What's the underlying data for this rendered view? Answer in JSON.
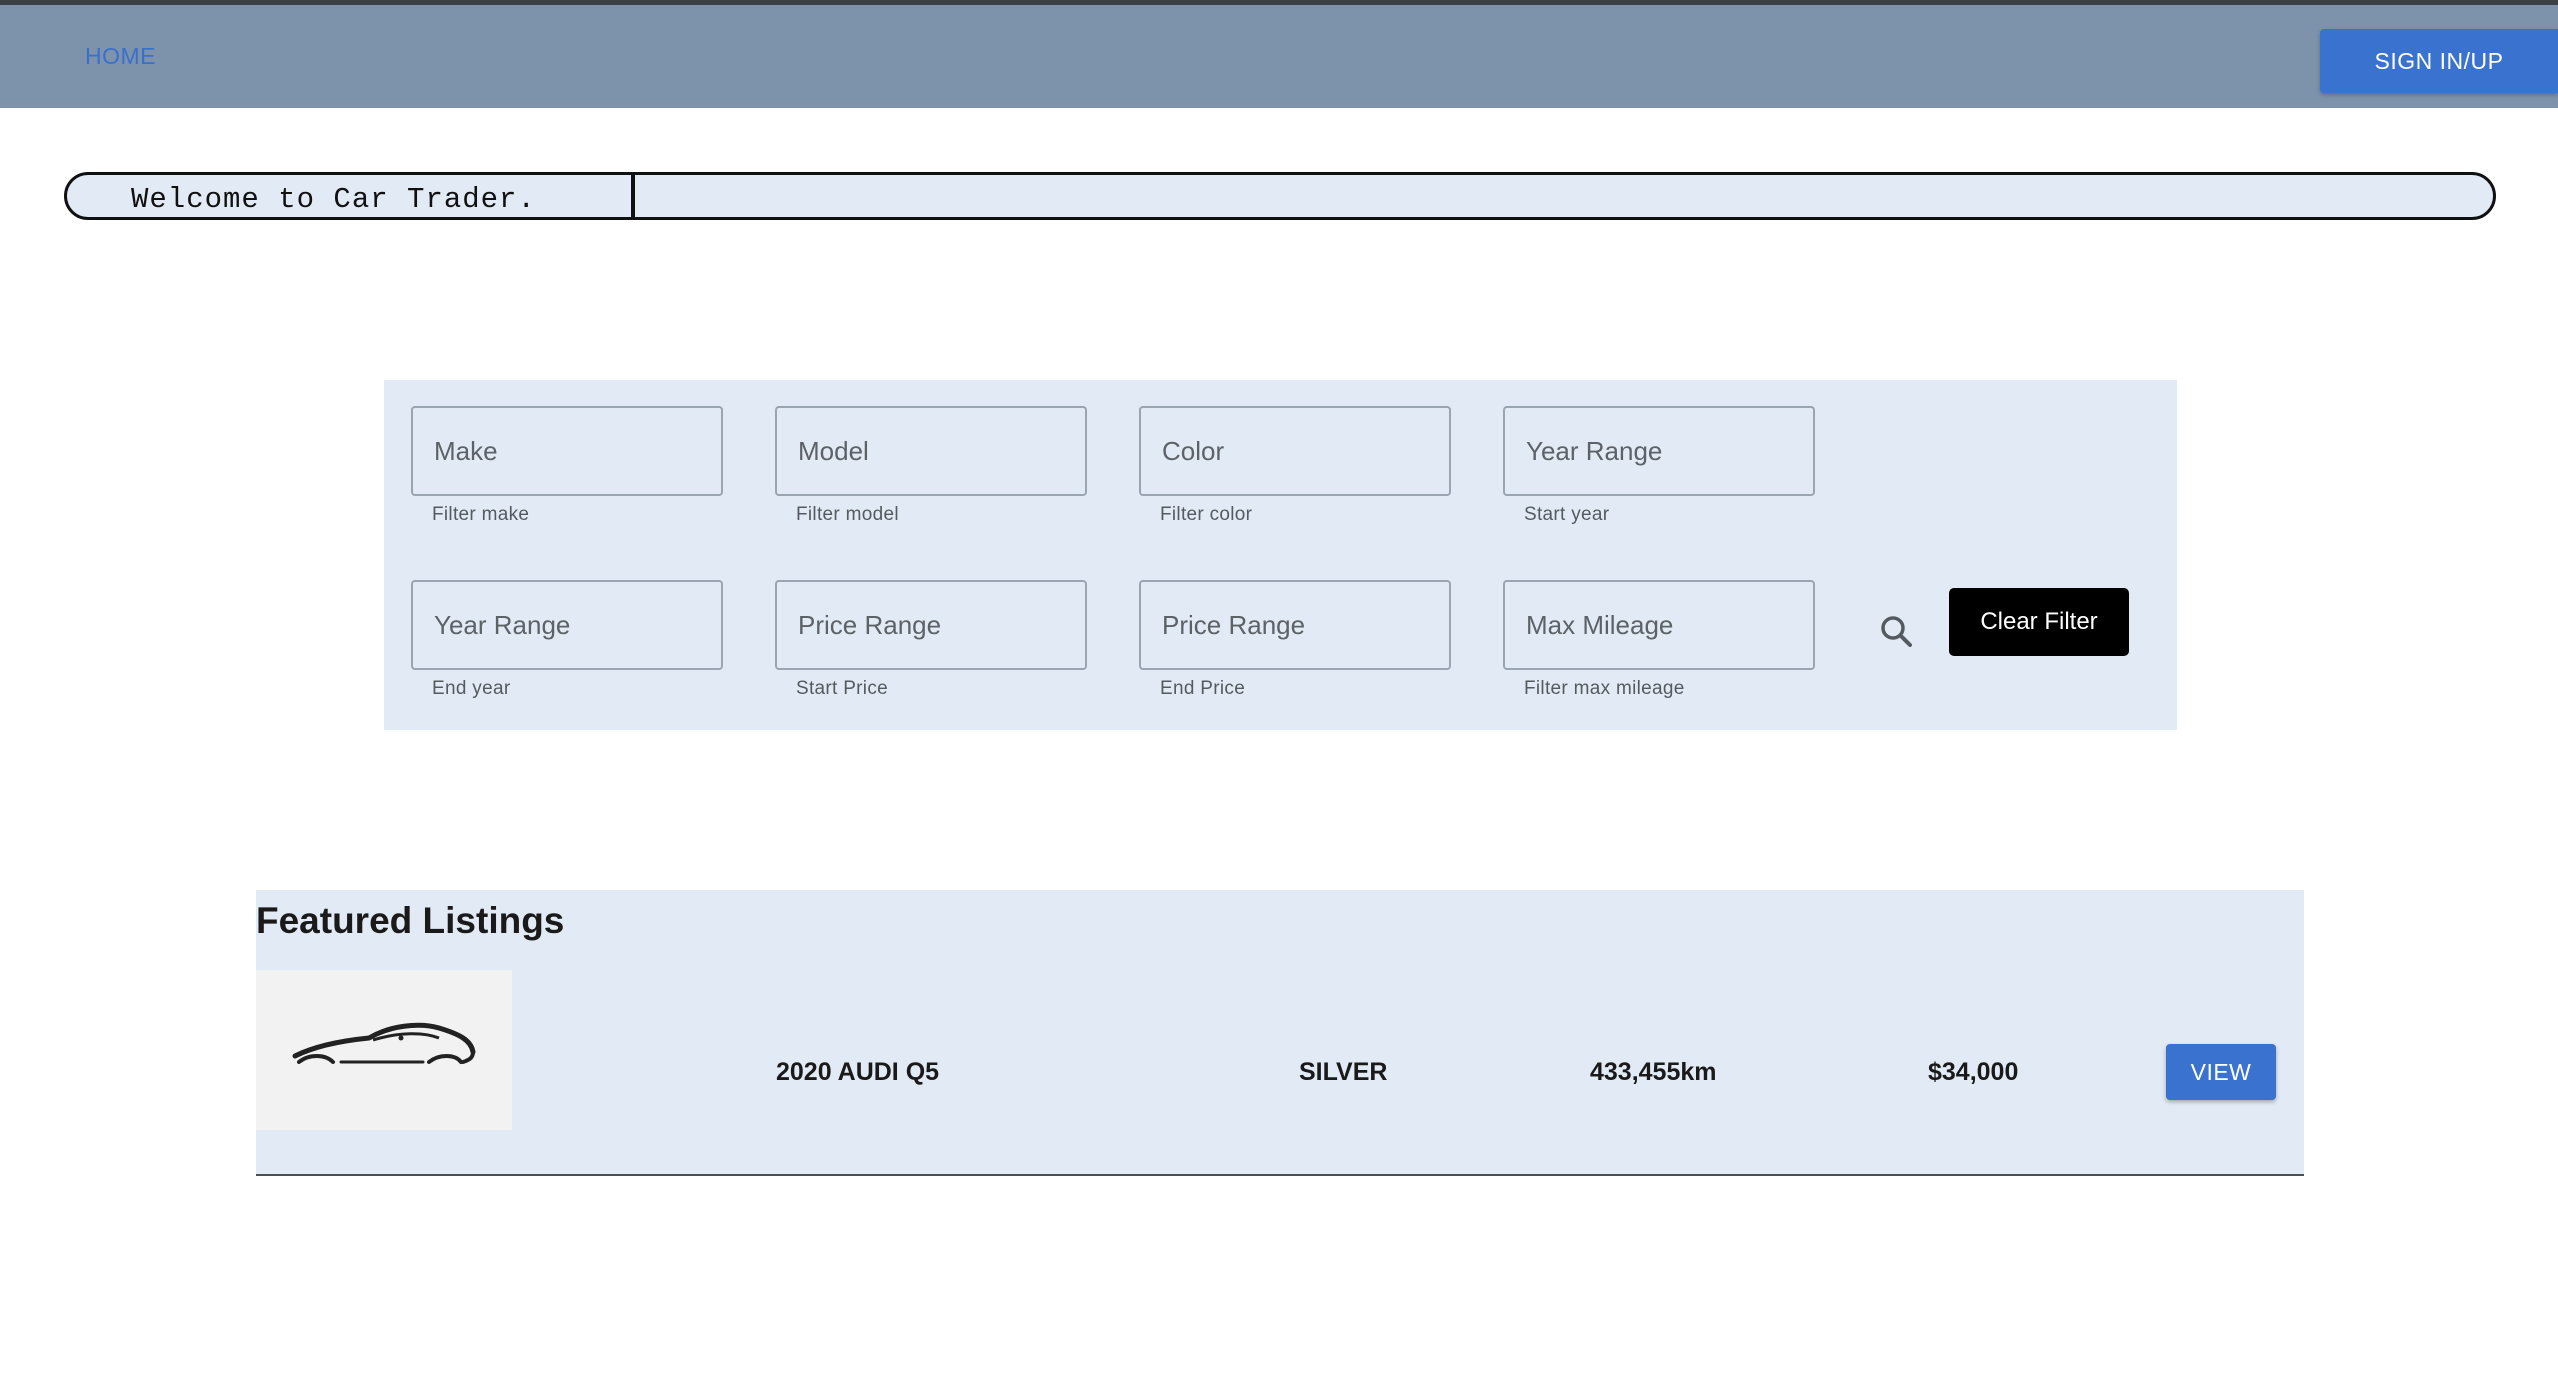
{
  "nav": {
    "home_label": "HOME",
    "signin_label": "SIGN IN/UP"
  },
  "welcome": {
    "text": "Welcome to Car Trader."
  },
  "filters": {
    "make": {
      "placeholder": "Make",
      "helper": "Filter make"
    },
    "model": {
      "placeholder": "Model",
      "helper": "Filter model"
    },
    "color": {
      "placeholder": "Color",
      "helper": "Filter color"
    },
    "year_start": {
      "placeholder": "Year Range",
      "helper": "Start year"
    },
    "year_end": {
      "placeholder": "Year Range",
      "helper": "End year"
    },
    "price_start": {
      "placeholder": "Price Range",
      "helper": "Start Price"
    },
    "price_end": {
      "placeholder": "Price Range",
      "helper": "End Price"
    },
    "max_mileage": {
      "placeholder": "Max Mileage",
      "helper": "Filter max mileage"
    },
    "search_icon": "search-icon",
    "clear_label": "Clear Filter"
  },
  "featured": {
    "title": "Featured Listings",
    "listings": [
      {
        "thumbnail_icon": "car-silhouette-icon",
        "name": "2020 AUDI Q5",
        "color": "SILVER",
        "mileage": "433,455km",
        "price": "$34,000",
        "view_label": "VIEW"
      }
    ]
  },
  "colors": {
    "nav_bg": "#7d93ab",
    "accent_blue": "#3a72cf",
    "panel_bg": "#e2ebf5"
  }
}
